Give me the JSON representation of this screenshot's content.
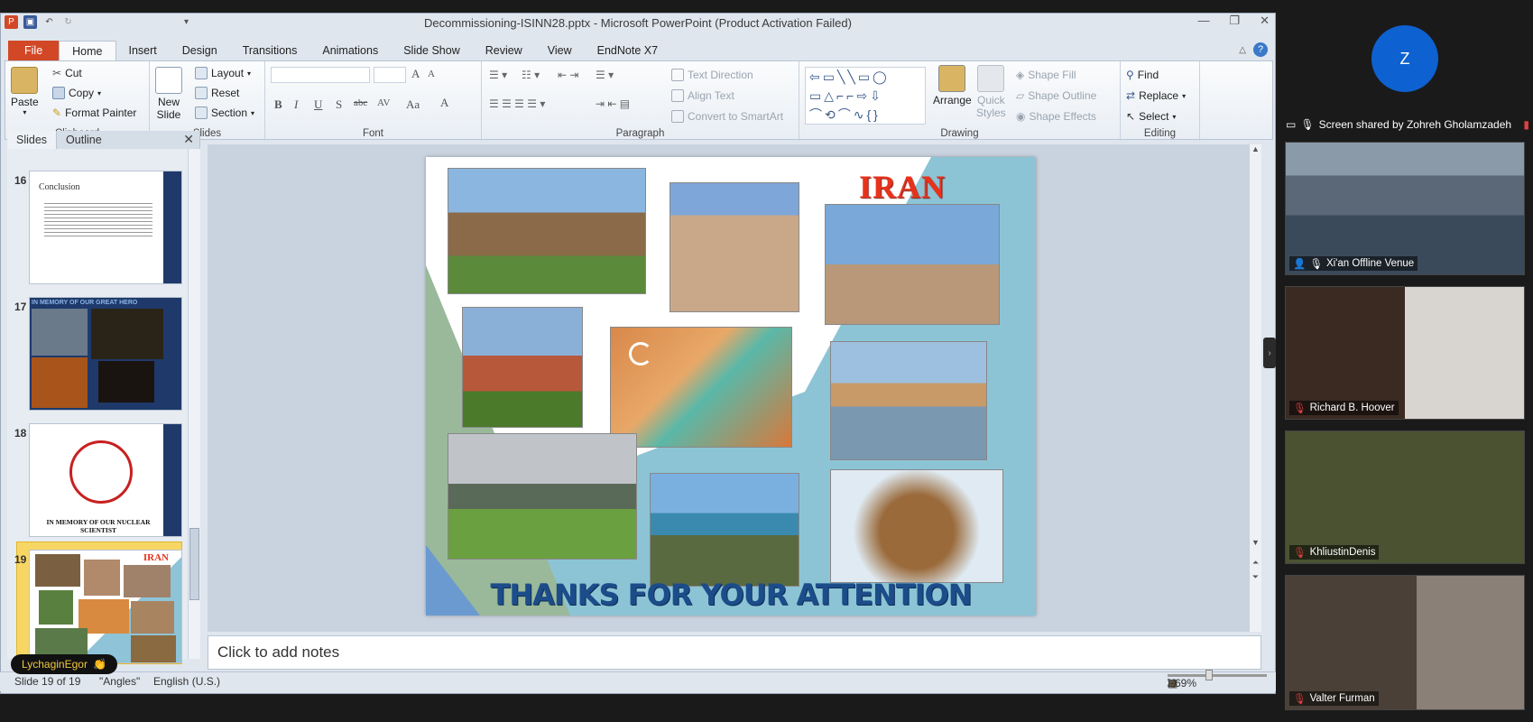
{
  "window": {
    "title": "Decommissioning-ISINN28.pptx - Microsoft PowerPoint (Product Activation Failed)",
    "controls": [
      "—",
      "❐",
      "✕"
    ]
  },
  "tabs": [
    "File",
    "Home",
    "Insert",
    "Design",
    "Transitions",
    "Animations",
    "Slide Show",
    "Review",
    "View",
    "EndNote X7"
  ],
  "ribbon": {
    "clipboard": {
      "label": "Clipboard",
      "paste": "Paste",
      "cut": "Cut",
      "copy": "Copy",
      "format_painter": "Format Painter"
    },
    "slides": {
      "label": "Slides",
      "new_slide_1": "New",
      "new_slide_2": "Slide",
      "layout": "Layout",
      "reset": "Reset",
      "section": "Section"
    },
    "font": {
      "label": "Font",
      "bold": "B",
      "italic": "I",
      "underline": "U",
      "shadow": "S",
      "strike": "abc",
      "spacing": "AV",
      "case": "Aa",
      "grow": "A",
      "shrink": "A",
      "color": "A"
    },
    "paragraph": {
      "label": "Paragraph",
      "text_direction": "Text Direction",
      "align_text": "Align Text",
      "convert_smartart": "Convert to SmartArt"
    },
    "drawing": {
      "label": "Drawing",
      "arrange": "Arrange",
      "quick_styles_1": "Quick",
      "quick_styles_2": "Styles",
      "shape_fill": "Shape Fill",
      "shape_outline": "Shape Outline",
      "shape_effects": "Shape Effects"
    },
    "editing": {
      "label": "Editing",
      "find": "Find",
      "replace": "Replace",
      "select": "Select"
    }
  },
  "left_pane": {
    "tabs": [
      "Slides",
      "Outline"
    ],
    "close": "✕",
    "thumbnails": [
      {
        "number": "16",
        "title": "Conclusion"
      },
      {
        "number": "17",
        "title": "IN MEMORY OF OUR GREAT HERO"
      },
      {
        "number": "18",
        "title": "IN MEMORY OF OUR NUCLEAR SCIENTIST"
      },
      {
        "number": "19",
        "title": "IRAN"
      }
    ]
  },
  "slide": {
    "title": "IRAN",
    "footer": "THANKS FOR YOUR ATTENTION"
  },
  "notes_placeholder": "Click to add notes",
  "status": {
    "slide_info": "Slide 19 of 19",
    "theme": "\"Angles\"",
    "language": "English (U.S.)",
    "zoom": "69%"
  },
  "reaction_badge": {
    "name": "LychaginEgor",
    "emoji": "👏"
  },
  "zoom": {
    "avatar_letter": "Z",
    "share_label": "Screen shared by Zohreh Gholamzadeh",
    "participants": [
      "Xi'an Offline Venue",
      "Richard B. Hoover",
      "KhliustinDenis",
      "Valter Furman"
    ]
  }
}
